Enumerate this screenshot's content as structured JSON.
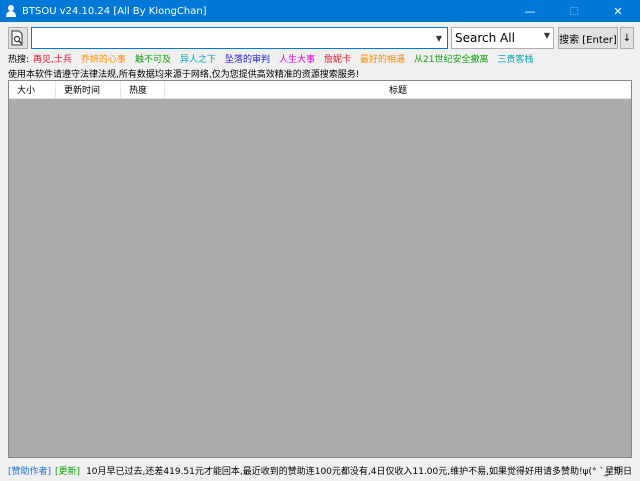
{
  "window": {
    "title": "BTSOU v24.10.24 [All By KiongChan]",
    "controls": {
      "minimize": "—",
      "maximize": "☐",
      "close": "✕"
    }
  },
  "toolbar": {
    "tool_icon": "document-search-icon",
    "search_value": "",
    "engine_selected": "Search All",
    "search_label": "搜索 [Enter]",
    "more_label": "↓"
  },
  "hot": {
    "label": "热搜:",
    "items": [
      {
        "text": "再见,士兵",
        "color": "#e81123"
      },
      {
        "text": "乔妍的心事",
        "color": "#ff8c00"
      },
      {
        "text": "触不可及",
        "color": "#10a010"
      },
      {
        "text": "异人之下",
        "color": "#00a5b5"
      },
      {
        "text": "坠落的审判",
        "color": "#1f1fd0"
      },
      {
        "text": "人生大事",
        "color": "#e000e0"
      },
      {
        "text": "詹妮卡",
        "color": "#e81123"
      },
      {
        "text": "最好的相遇",
        "color": "#ff8c00"
      },
      {
        "text": "从21世纪安全撤离",
        "color": "#10a010"
      },
      {
        "text": "三贵客栈",
        "color": "#00a5b5"
      }
    ]
  },
  "notice": "使用本软件请遵守法律法规,所有数据均来源于网络,仅为您提供高效精准的资源搜索服务!",
  "table": {
    "headers": [
      "大小",
      "更新时间",
      "热度",
      "标题"
    ],
    "rows": []
  },
  "status": {
    "sponsor_link": "[赞助作者]",
    "update_link": "[更新]",
    "message": "10月早已过去,还差419.51元才能回本,最近收到的赞助连100元都没有,4日仅收入11.00元,维护不易,如果觉得好用请多赞助!ψ(° `_´°)",
    "weekday": "星期日",
    "link_color": "#1f6fd0",
    "update_color": "#10a010"
  },
  "colors": {
    "titlebar": "#0078d7",
    "list_bg": "#ababab"
  }
}
